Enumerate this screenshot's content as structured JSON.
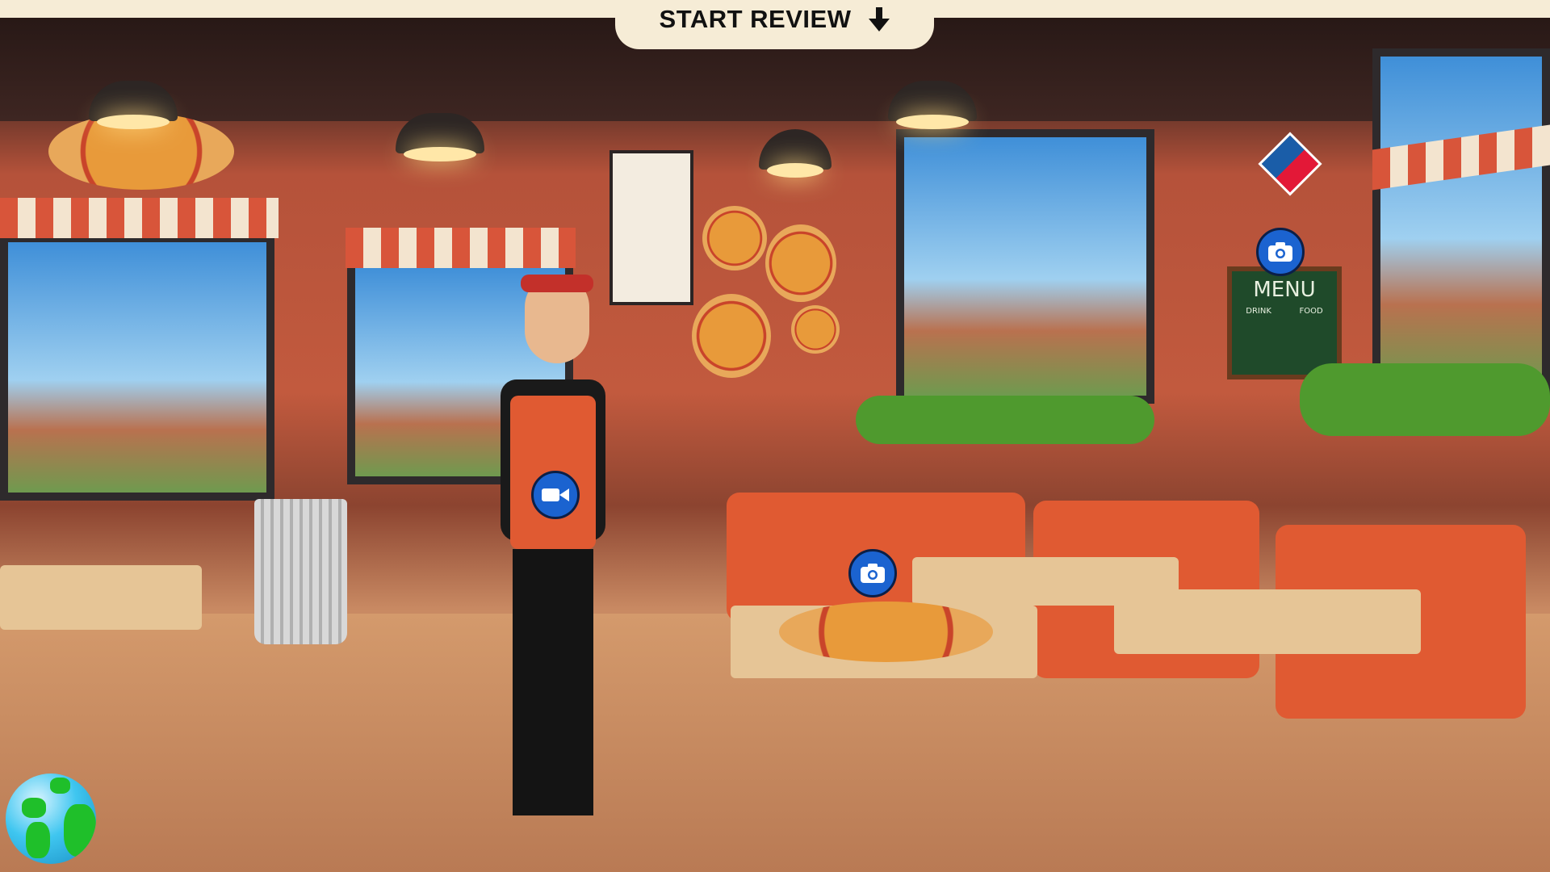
{
  "header": {
    "review_button_label": "START REVIEW",
    "review_icon": "arrow-down-icon"
  },
  "hotspots": [
    {
      "type": "video",
      "icon": "video-camera-icon"
    },
    {
      "type": "photo",
      "icon": "camera-icon"
    },
    {
      "type": "photo",
      "icon": "camera-icon"
    }
  ],
  "scene": {
    "menu_board_title": "MENU",
    "menu_col_1": "DRINK",
    "menu_col_2": "FOOD"
  },
  "globe": {
    "icon": "globe-icon"
  },
  "colors": {
    "hotspot": "#1b63d0",
    "bar": "#f6ecd6"
  }
}
